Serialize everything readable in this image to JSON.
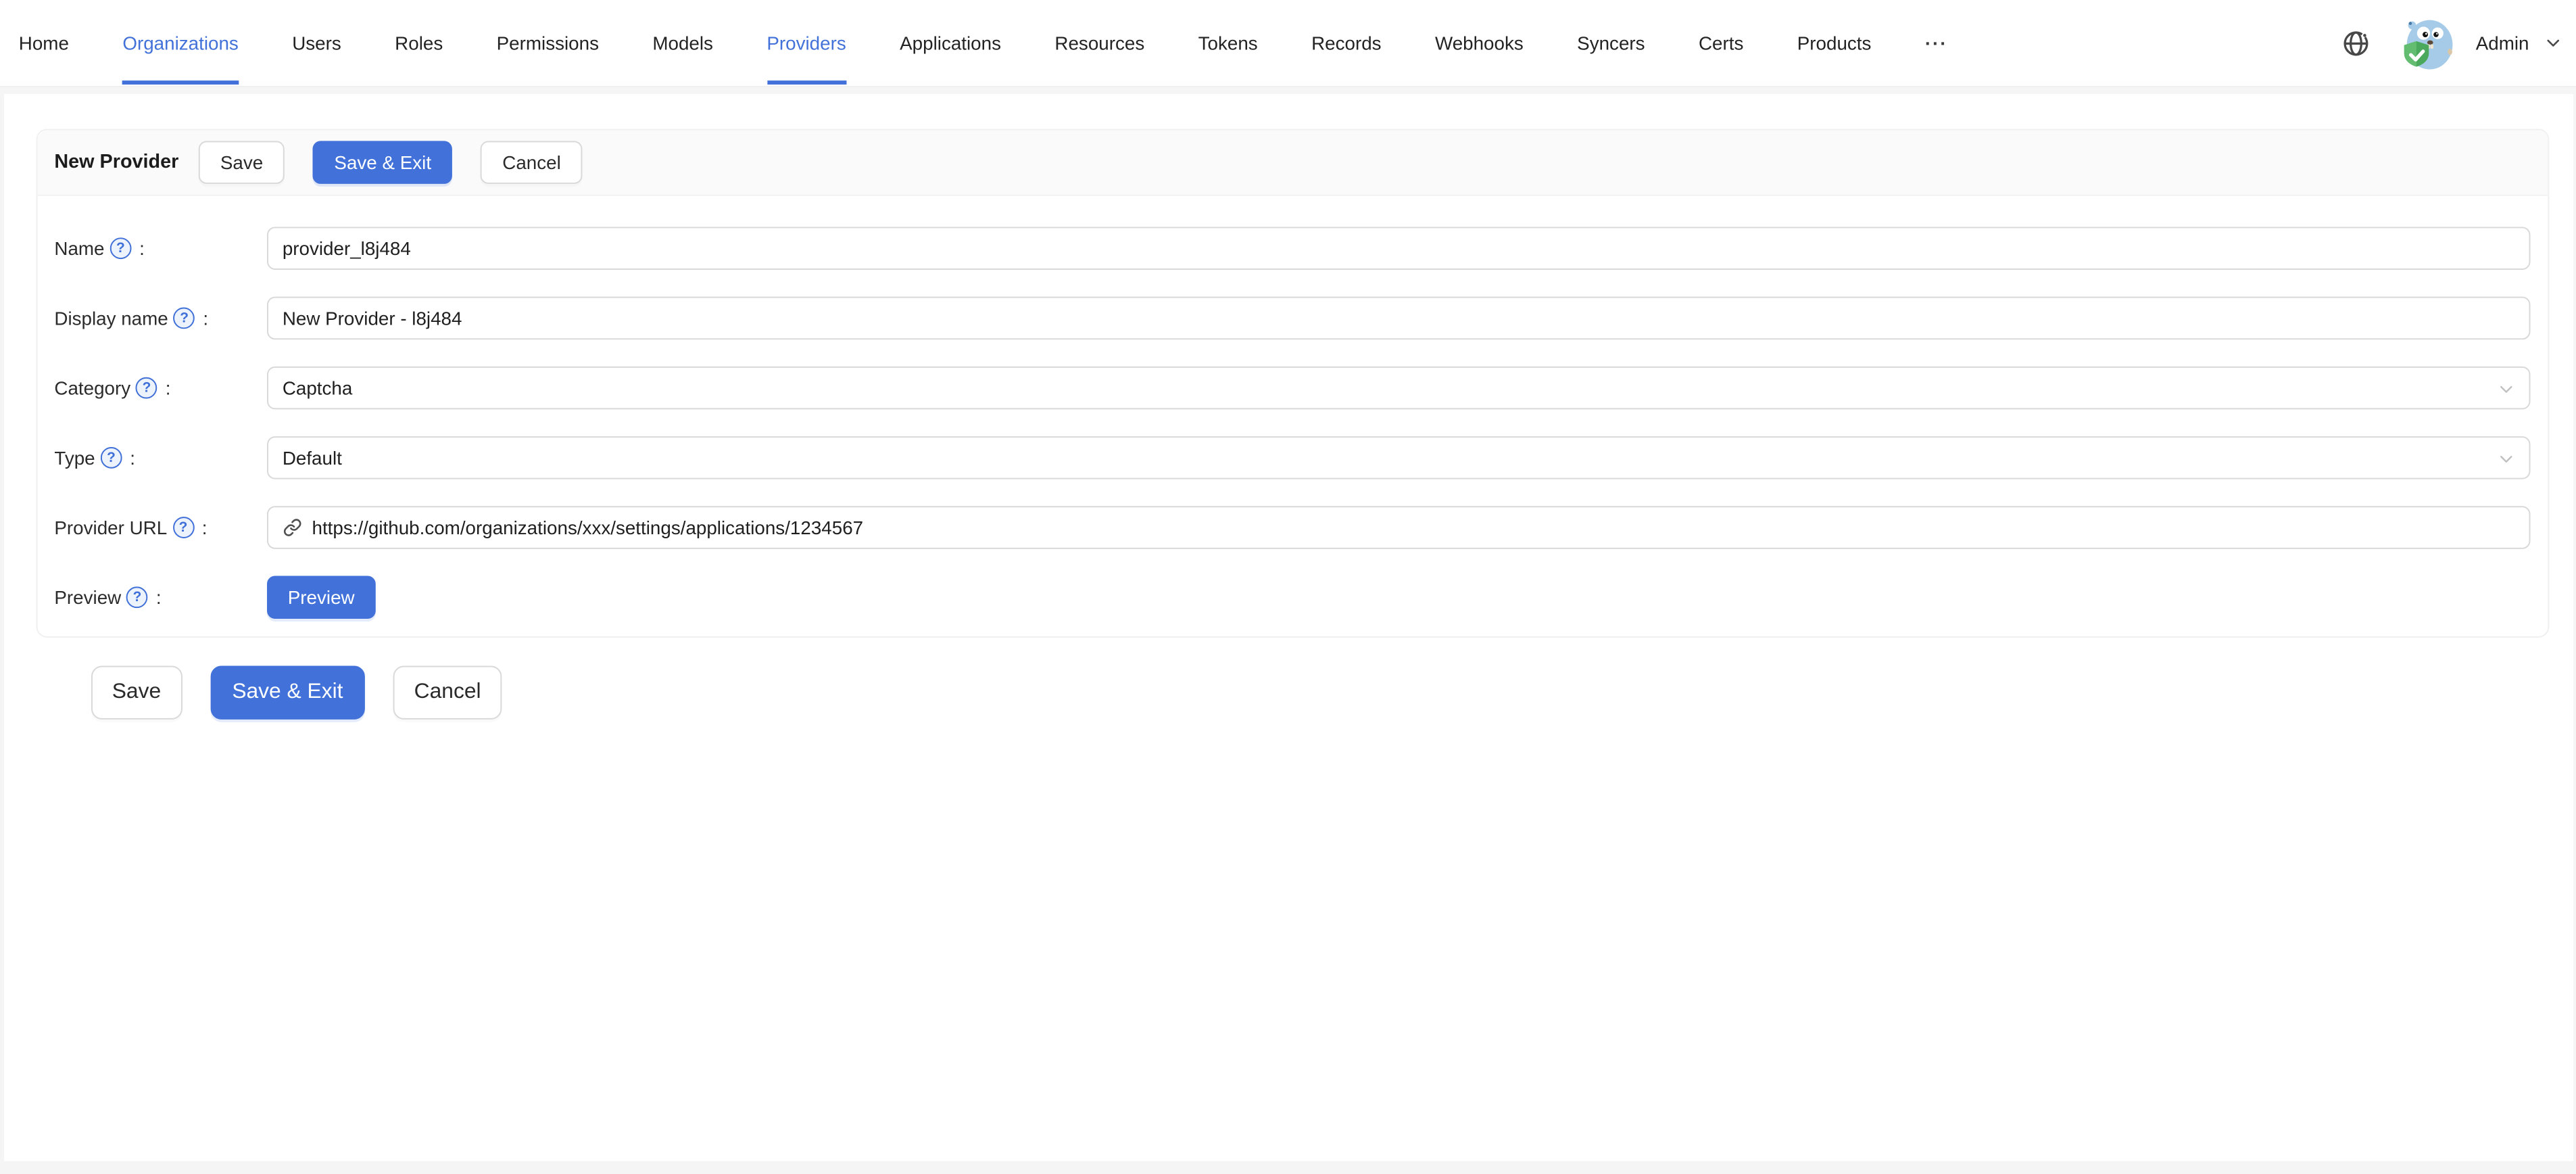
{
  "colors": {
    "accent": "#4272d9",
    "page_bg": "#f5f5f5",
    "card_head_bg": "#fafafa",
    "card_border": "#f0f0f0",
    "input_border": "#d9d9d9",
    "text": "#1f1f1f",
    "muted_icon": "#bfbfbf"
  },
  "icons": {
    "language": "globe-icon",
    "user_menu": "chevron-down-icon",
    "select_suffix": "chevron-down-icon",
    "label_help": "question-circle-icon",
    "url_prefix": "link-icon",
    "avatar": "casdoor-gopher-avatar"
  },
  "nav": {
    "items": [
      "Home",
      "Organizations",
      "Users",
      "Roles",
      "Permissions",
      "Models",
      "Providers",
      "Applications",
      "Resources",
      "Tokens",
      "Records",
      "Webhooks",
      "Syncers",
      "Certs",
      "Products"
    ],
    "active_items": [
      "Organizations",
      "Providers"
    ],
    "overflow": "···",
    "user": {
      "name": "Admin"
    }
  },
  "card": {
    "title": "New Provider",
    "actions": {
      "save": "Save",
      "save_exit": "Save & Exit",
      "cancel": "Cancel"
    }
  },
  "form": {
    "help_glyph": "?",
    "colon": ":",
    "name": {
      "label": "Name",
      "value": "provider_l8j484"
    },
    "display_name": {
      "label": "Display name",
      "value": "New Provider - l8j484"
    },
    "category": {
      "label": "Category",
      "value": "Captcha"
    },
    "type": {
      "label": "Type",
      "value": "Default"
    },
    "provider_url": {
      "label": "Provider URL",
      "value": "https://github.com/organizations/xxx/settings/applications/1234567"
    },
    "preview": {
      "label": "Preview",
      "button": "Preview"
    }
  },
  "footer_actions": {
    "save": "Save",
    "save_exit": "Save & Exit",
    "cancel": "Cancel"
  }
}
